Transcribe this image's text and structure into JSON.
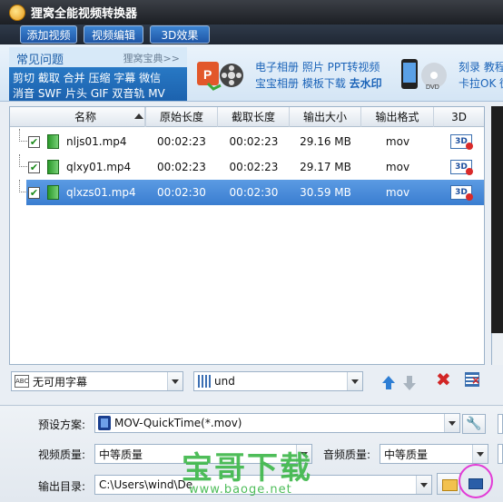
{
  "window": {
    "title": "狸窝全能视频转换器"
  },
  "toolbar": {
    "add_video": "添加视频",
    "edit_video": "视频编辑",
    "effect_3d": "3D效果"
  },
  "banner": {
    "faq_title": "常见问题",
    "faq_more": "狸窝宝典>>",
    "faq_line1": "剪切 截取 合并 压缩 字幕 微信",
    "faq_line2": "消音 SWF 片头 GIF 双音轨 MV",
    "promo1_line1": "电子相册 照片 PPT转视频",
    "promo1_line2_a": "宝宝相册 模板下载",
    "promo1_line2_b": "去水印",
    "promo2_line1": "刻录 教程",
    "promo2_line2": "卡拉OK 微"
  },
  "table": {
    "headers": [
      "名称",
      "原始长度",
      "截取长度",
      "输出大小",
      "输出格式",
      "3D"
    ],
    "rows": [
      {
        "name": "nljs01.mp4",
        "orig": "00:02:23",
        "clip": "00:02:23",
        "size": "29.16 MB",
        "fmt": "mov",
        "checked": "✔",
        "icon3d": "3D"
      },
      {
        "name": "qlxy01.mp4",
        "orig": "00:02:23",
        "clip": "00:02:23",
        "size": "29.17 MB",
        "fmt": "mov",
        "checked": "✔",
        "icon3d": "3D"
      },
      {
        "name": "qlxzs01.mp4",
        "orig": "00:02:30",
        "clip": "00:02:30",
        "size": "30.59 MB",
        "fmt": "mov",
        "checked": "✔",
        "icon3d": "3D"
      }
    ]
  },
  "midbar": {
    "subtitle_value": "无可用字幕",
    "subtitle_icon": "ABC",
    "audio_value": "und",
    "delete_icon": "✖"
  },
  "output": {
    "preset_label": "预设方案:",
    "preset_value": "MOV-QuickTime(*.mov)",
    "video_quality_label": "视频质量:",
    "video_quality_value": "中等质量",
    "audio_quality_label": "音频质量:",
    "audio_quality_value": "中等质量",
    "dir_label": "输出目录:",
    "dir_value": "C:\\Users\\wind\\De",
    "settings_icon": "🔧"
  },
  "watermark": {
    "big": "宝哥下载",
    "small": "www.baoge.net"
  },
  "colors": {
    "accent": "#3a7dd0",
    "title_bar": "#1c1f24",
    "watermark": "#3fb84c",
    "highlight": "#e23bd6"
  }
}
